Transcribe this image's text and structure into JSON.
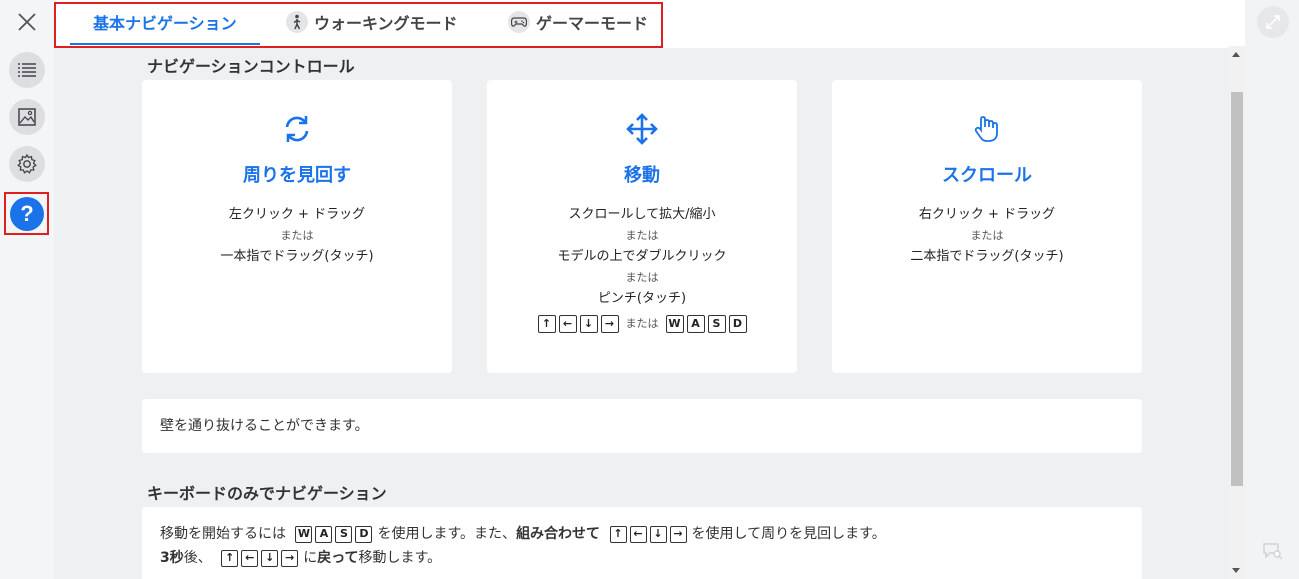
{
  "colors": {
    "accent": "#1a73e8",
    "highlight_border": "#e02020"
  },
  "tabs": [
    {
      "label": "基本ナビゲーション",
      "icon": "none",
      "active": true
    },
    {
      "label": "ウォーキングモード",
      "icon": "walking-person-icon",
      "active": false
    },
    {
      "label": "ゲーマーモード",
      "icon": "gamepad-icon",
      "active": false
    }
  ],
  "sections": {
    "nav_controls_title": "ナビゲーションコントロール",
    "keyboard_title": "キーボードのみでナビゲーション"
  },
  "cards": [
    {
      "icon": "rotate-arrows-icon",
      "title": "周りを見回す",
      "lines": [
        "左クリック + ドラッグ",
        "または",
        "一本指でドラッグ(タッチ)"
      ]
    },
    {
      "icon": "move-arrows-icon",
      "title": "移動",
      "lines": [
        "スクロールして拡大/縮小",
        "または",
        "モデルの上でダブルクリック",
        "または",
        "ピンチ(タッチ)"
      ],
      "keys_or": "または",
      "arrow_keys": [
        "↑",
        "←",
        "↓",
        "→"
      ],
      "wasd_keys": [
        "W",
        "A",
        "S",
        "D"
      ]
    },
    {
      "icon": "hand-pointer-icon",
      "title": "スクロール",
      "lines": [
        "右クリック + ドラッグ",
        "または",
        "二本指でドラッグ(タッチ)"
      ]
    }
  ],
  "note": "壁を通り抜けることができます。",
  "keyboard": {
    "line1_a": "移動を開始するには",
    "line1_b": "を使用します。また、",
    "line1_bold": "組み合わせて",
    "line1_c": "を使用して周りを見回します。",
    "line2_bold_a": "3秒",
    "line2_a": "後、",
    "line2_b": "に",
    "line2_bold_b": "戻って",
    "line2_c": "移動します。"
  },
  "rail": {
    "items": [
      "close-icon",
      "list-icon",
      "image-icon",
      "gear-icon",
      "help-icon"
    ],
    "help_label": "?"
  }
}
